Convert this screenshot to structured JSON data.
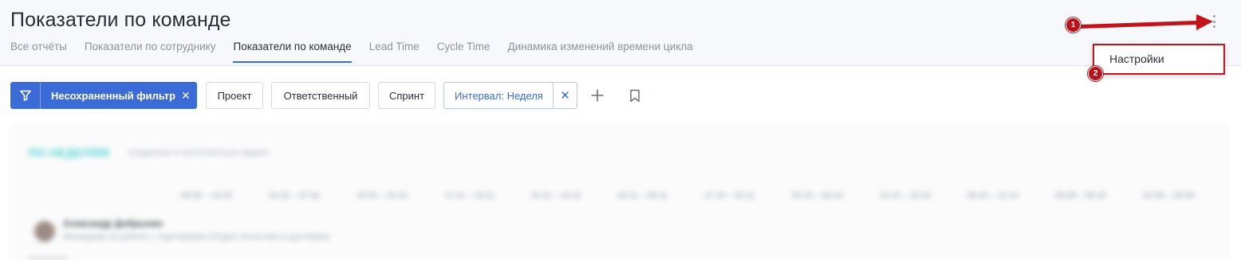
{
  "header": {
    "title": "Показатели по команде",
    "tabs": [
      {
        "label": "Все отчёты",
        "active": false
      },
      {
        "label": "Показатели по сотруднику",
        "active": false
      },
      {
        "label": "Показатели по команде",
        "active": true
      },
      {
        "label": "Lead Time",
        "active": false
      },
      {
        "label": "Cycle Time",
        "active": false
      },
      {
        "label": "Динамика изменений времени цикла",
        "active": false
      }
    ],
    "more_icon": "kebab-vertical-icon"
  },
  "menu": {
    "items": [
      {
        "label": "Настройки"
      }
    ]
  },
  "annotations": {
    "marker_1": "1",
    "marker_2": "2",
    "color": "#b5141a"
  },
  "toolbar": {
    "filter_icon": "filter-funnel-icon",
    "filter_label": "Несохраненный фильтр",
    "filter_close": "✕",
    "chips": [
      "Проект",
      "Ответственный",
      "Спринт"
    ],
    "interval_label": "Интервал: Неделя",
    "interval_close": "✕",
    "add_icon": "plus-icon",
    "bookmark_icon": "bookmark-icon"
  },
  "colors": {
    "accent": "#3b6bd6",
    "annotation_red": "#c0141a",
    "header_bg": "#f7f8fb",
    "teal_heading": "#58d6d4"
  },
  "blurred_report": {
    "title": "ПО НЕДЕЛЯМ",
    "subtitle": "созданные и выполненные задачи",
    "weeks": [
      "08.02 – 14.02",
      "01.02 – 07.02",
      "25.01 – 31.01",
      "17.11 – 23.11",
      "10.11 – 16.11",
      "03.11 – 09.11",
      "27.10 – 02.11",
      "20.10 – 26.10",
      "13.10 – 19.10",
      "06.10 – 12.10",
      "29.09 – 05.10",
      "22.09 – 28.09"
    ],
    "person_name": "Александр Добрынин",
    "person_role": "Менеджер по работе с партнёрами (Отдел логистики и доставки)"
  }
}
